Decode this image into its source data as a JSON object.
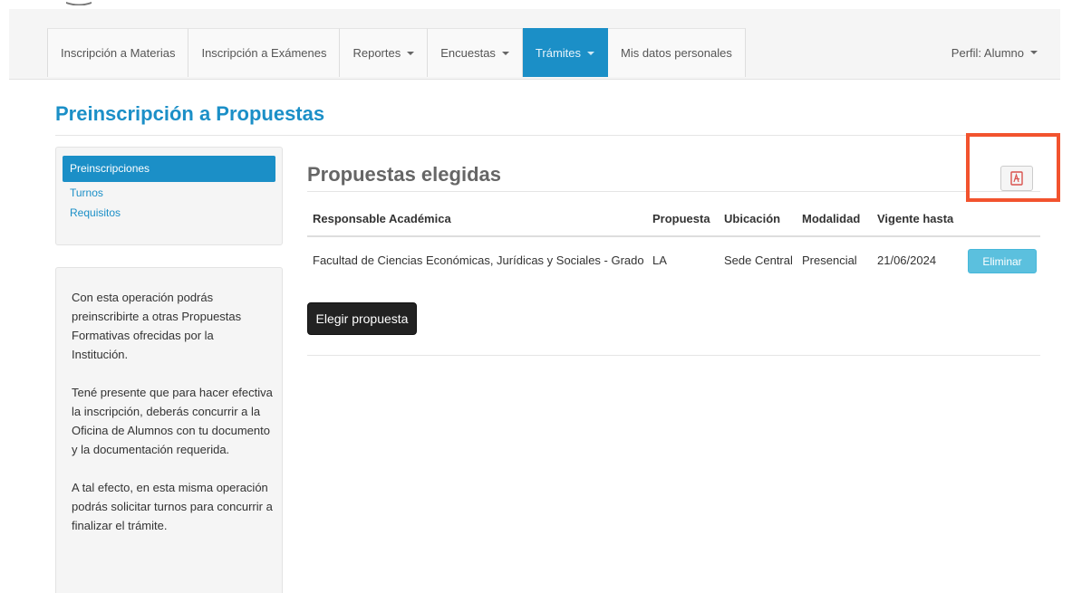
{
  "nav": {
    "items": [
      {
        "label": "Inscripción a Materias",
        "has_caret": false,
        "active": false
      },
      {
        "label": "Inscripción a Exámenes",
        "has_caret": false,
        "active": false
      },
      {
        "label": "Reportes",
        "has_caret": true,
        "active": false
      },
      {
        "label": "Encuestas",
        "has_caret": true,
        "active": false
      },
      {
        "label": "Trámites",
        "has_caret": true,
        "active": true
      },
      {
        "label": "Mis datos personales",
        "has_caret": false,
        "active": false
      }
    ],
    "profile_label": "Perfil: Alumno"
  },
  "page": {
    "title": "Preinscripción a Propuestas"
  },
  "sidebar": {
    "items": [
      {
        "label": "Preinscripciones",
        "active": true
      },
      {
        "label": "Turnos",
        "active": false
      },
      {
        "label": "Requisitos",
        "active": false
      }
    ],
    "info": [
      "Con esta operación podrás preinscribirte a otras Propuestas Formativas ofrecidas por la Institución.",
      "Tené presente que para hacer efectiva la inscripción, deberás concurrir a la Oficina de Alumnos con tu documento y la documentación requerida.",
      "A tal efecto, en esta misma operación podrás solicitar turnos para concurrir a finalizar el trámite."
    ]
  },
  "section": {
    "title": "Propuestas elegidas"
  },
  "table": {
    "headers": [
      "Responsable Académica",
      "Propuesta",
      "Ubicación",
      "Modalidad",
      "Vigente hasta"
    ],
    "rows": [
      {
        "cells": [
          "Facultad de Ciencias Económicas, Jurídicas y Sociales - Grado",
          "LA",
          "Sede Central",
          "Presencial",
          "21/06/2024"
        ],
        "action_label": "Eliminar"
      }
    ]
  },
  "actions": {
    "elegir_label": "Elegir propuesta",
    "pdf_icon": "pdf-file-icon"
  },
  "colors": {
    "accent": "#1b8fc7",
    "info_button": "#5bc0de",
    "dark_button": "#222222",
    "highlight": "#f2532e"
  }
}
